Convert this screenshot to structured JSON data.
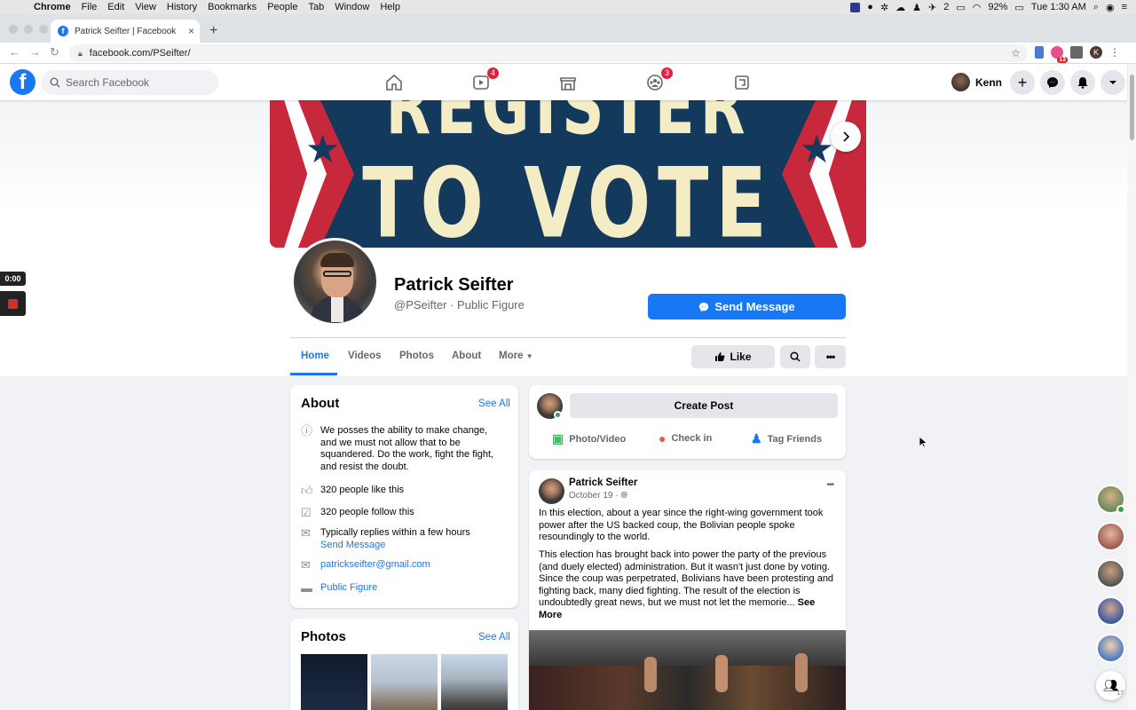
{
  "macos": {
    "app_name": "Chrome",
    "menu": [
      "File",
      "Edit",
      "View",
      "History",
      "Bookmarks",
      "People",
      "Tab",
      "Window",
      "Help"
    ],
    "notification_count": "2",
    "battery": "92%",
    "clock": "Tue 1:30 AM"
  },
  "browser": {
    "tab_title": "Patrick Seifter | Facebook",
    "url": "facebook.com/PSeifter/",
    "extension_badge": "13",
    "profile_initial": "K"
  },
  "fb_header": {
    "search_placeholder": "Search Facebook",
    "watch_badge": "4",
    "groups_badge": "3",
    "user_name": "Kenn"
  },
  "cover": {
    "line1": "REGISTER",
    "line2": "TO VOTE"
  },
  "profile": {
    "name": "Patrick Seifter",
    "handle": "@PSeifter · Public Figure",
    "send_message": "Send Message",
    "tabs": [
      "Home",
      "Videos",
      "Photos",
      "About",
      "More"
    ],
    "like_label": "Like"
  },
  "about": {
    "title": "About",
    "see_all": "See All",
    "description": "We posses the ability to make change, and we must not allow that to be squandered. Do the work, fight the fight, and resist the doubt.",
    "likes": "320 people like this",
    "follows": "320 people follow this",
    "replies": "Typically replies within a few hours",
    "send_message_link": "Send Message",
    "email": "patrickseifter@gmail.com",
    "category": "Public Figure"
  },
  "photos": {
    "title": "Photos",
    "see_all": "See All"
  },
  "create_post": {
    "button": "Create Post",
    "photo_video": "Photo/Video",
    "check_in": "Check in",
    "tag_friends": "Tag Friends"
  },
  "post": {
    "author": "Patrick Seifter",
    "date": "October 19 · ",
    "para1": "In this election, about a year since the right-wing government took power after the US backed coup, the Bolivian people spoke resoundingly to the world.",
    "para2": "This election has brought back into power the party of the previous (and duely elected) administration. But it wasn't just done by voting. Since the coup was perpetrated, Bolivians have been protesting and fighting back, many died fighting. The result of the election is undoubtedly great news, but we must not let the memorie...",
    "see_more": "See More"
  },
  "recorder": {
    "time": "0:00"
  },
  "contacts": {
    "group_badge": "17"
  }
}
